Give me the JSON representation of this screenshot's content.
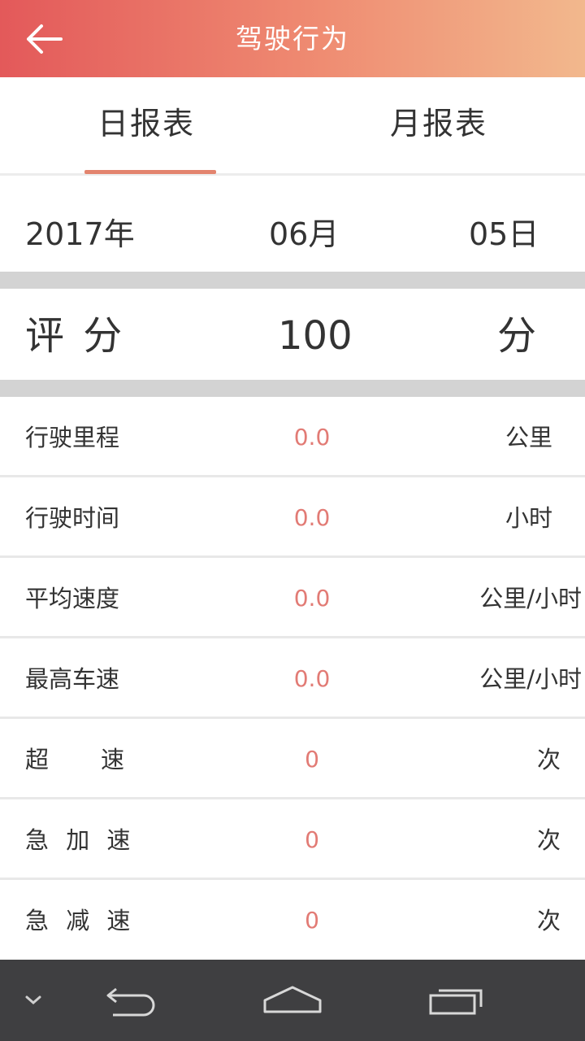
{
  "header": {
    "title": "驾驶行为",
    "back_icon": "arrow-left-icon"
  },
  "tabs": [
    {
      "label": "日报表",
      "active": true
    },
    {
      "label": "月报表",
      "active": false
    }
  ],
  "date": {
    "year": "2017年",
    "month": "06月",
    "day": "05日"
  },
  "score": {
    "label": "评 分",
    "value": "100",
    "unit": "分"
  },
  "stats": [
    {
      "label": "行驶里程",
      "value": "0.0",
      "unit": "公里"
    },
    {
      "label": "行驶时间",
      "value": "0.0",
      "unit": "小时"
    },
    {
      "label": "平均速度",
      "value": "0.0",
      "unit": "公里/小时"
    },
    {
      "label": "最高车速",
      "value": "0.0",
      "unit": "公里/小时"
    },
    {
      "label": "超　　速",
      "value": "0",
      "unit": "次"
    },
    {
      "label": "急 加 速",
      "value": "0",
      "unit": "次"
    },
    {
      "label": "急 减 速",
      "value": "0",
      "unit": "次"
    }
  ],
  "colors": {
    "accent": "#e3846e",
    "value": "#e27b75",
    "header_start": "#e3595a",
    "header_end": "#f2b88d"
  }
}
